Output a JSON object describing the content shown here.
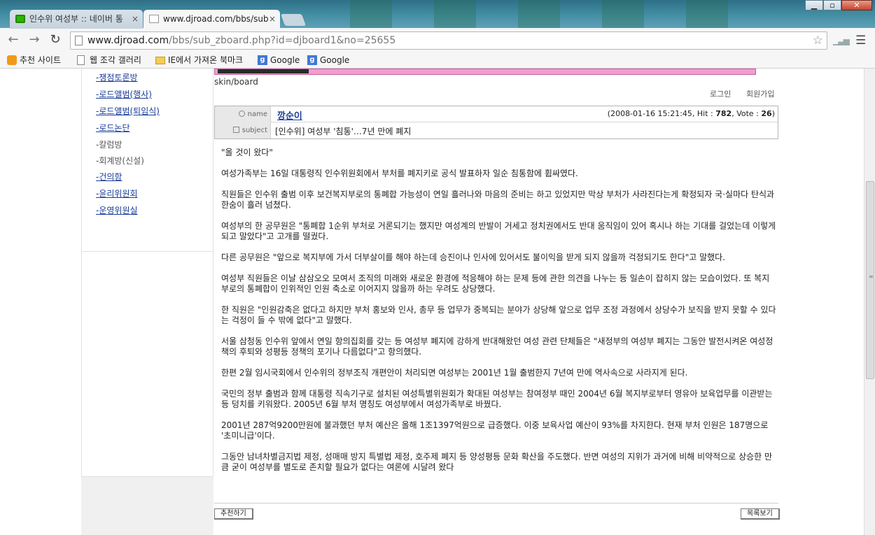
{
  "browser": {
    "tabs": [
      {
        "label": "인수위 여성부 :: 네이버 통",
        "active": false
      },
      {
        "label": "www.djroad.com/bbs/sub",
        "active": true
      }
    ],
    "tab_close_glyph": "×",
    "address": {
      "host": "www.djroad.com",
      "path": "/bbs/sub_zboard.php?id=djboard1&no=25655"
    },
    "bookmarks": [
      {
        "label": "추천 사이트",
        "icon": "star-bookmark-icon"
      },
      {
        "label": "웹 조각 갤러리",
        "icon": "page-icon"
      },
      {
        "label": "IE에서 가져온 북마크",
        "icon": "folder-icon"
      },
      {
        "label": "Google",
        "icon": "google-icon"
      },
      {
        "label": "Google",
        "icon": "google-icon"
      }
    ]
  },
  "leftnav": {
    "items": [
      {
        "label": "-쟁점토론방",
        "link": true
      },
      {
        "label": "-로드앨범(행사)",
        "link": true
      },
      {
        "label": "-로드앨범(퇴임식)",
        "link": true
      },
      {
        "label": "-로드논단",
        "link": true
      },
      {
        "label": "-칼럼방",
        "link": false
      },
      {
        "label": "-회계방(신설)",
        "link": false
      },
      {
        "label": "-건의함",
        "link": true
      },
      {
        "label": "-윤리위원회",
        "link": true
      },
      {
        "label": "-운영위원실",
        "link": true
      }
    ]
  },
  "board": {
    "skin_path": "skin/board",
    "login_label": "로그인",
    "join_label": "회원가입",
    "name_label": "name",
    "subject_label": "subject",
    "author": "깡순이",
    "meta_date": "(2008-01-16 15:21:45, Hit : ",
    "hit": "782",
    "vote_label": ", Vote : ",
    "vote": "26",
    "meta_close": ")",
    "subject": "[인수위] 여성부 '침통'…7년 만에 폐지",
    "recommend_label": "추천하기",
    "list_label": "목록보기"
  },
  "article": {
    "paragraphs": [
      "\"올 것이 왔다\"",
      "여성가족부는 16일 대통령직 인수위원회에서 부처를 폐지키로 공식 발표하자 일순 침통함에 휩싸였다.",
      "직원들은 인수위 출범 이후 보건복지부로의 통폐합 가능성이 연일 흘러나와 마음의 준비는 하고 있었지만 막상 부처가 사라진다는게 확정되자 국·실마다 탄식과 한숨이 흘러 넘쳤다.",
      "여성부의 한 공무원은 \"통폐합 1순위 부처로 거론되기는 했지만 여성계의 반발이 거세고 정치권에서도 반대 움직임이 있어 혹시나 하는 기대를 걸었는데 이렇게 되고 말았다\"고 고개를 떨궜다.",
      "다른 공무원은 \"앞으로 복지부에 가서 더부살이를 해야 하는데 승진이나 인사에 있어서도 불이익을 받게 되지 않을까 걱정되기도 한다\"고 말했다.",
      "여성부 직원들은 이날 삼삼오오 모여서 조직의 미래와 새로운 환경에 적응해야 하는 문제 등에 관한 의견을 나누는 등 일손이 잡히지 않는 모습이었다. 또 복지부로의 통폐합이 인위적인 인원 축소로 이어지지 않을까 하는 우려도 상당했다.",
      "한 직원은 \"인원감축은 없다고 하지만 부처 홍보와 인사, 총무 등 업무가 중복되는 분야가 상당해 앞으로 업무 조정 과정에서 상당수가 보직을 받지 못할 수 있다는 걱정이 들 수 밖에 없다\"고 말했다.",
      "서울 삼청동 인수위 앞에서 연일 항의집회를 갖는 등 여성부 폐지에 강하게 반대해왔던 여성 관련 단체들은 \"새정부의 여성부 폐지는 그동안 발전시켜온 여성정책의 후퇴와 성평등 정책의 포기나 다름없다\"고 항의했다.",
      "한편 2월 임시국회에서 인수위의 정부조직 개편안이 처리되면 여성부는 2001년 1월 출범한지 7년여 만에 역사속으로 사라지게 된다.",
      "국민의 정부 출범과 함께 대통령 직속기구로 설치된 여성특별위원회가 확대된 여성부는 참여정부 때인 2004년 6월 복지부로부터 영유아 보육업무를 이관받는 등 덩치를 키워왔다. 2005년 6월 부처 명칭도 여성부에서 여성가족부로 바꿨다.",
      "2001년 287억9200만원에 불과했던 부처 예산은 올해 1조1397억원으로 급증했다. 이중 보육사업 예산이 93%를 차지한다. 현재 부처 인원은 187명으로 '초미니급'이다.",
      "그동안 남녀차별금지법 제정, 성매매 방지 특별법 제정, 호주제 폐지 등 양성평등 문화 확산을 주도했다. 반면 여성의 지위가 과거에 비해 비약적으로 상승한 만큼 굳이 여성부를 별도로 존치할 필요가 없다는 여론에 시달려 왔다"
    ]
  },
  "colors": {
    "link": "#1a3d99",
    "pink_banner": "#f49bd0",
    "label_bg": "#e8e8e8"
  }
}
